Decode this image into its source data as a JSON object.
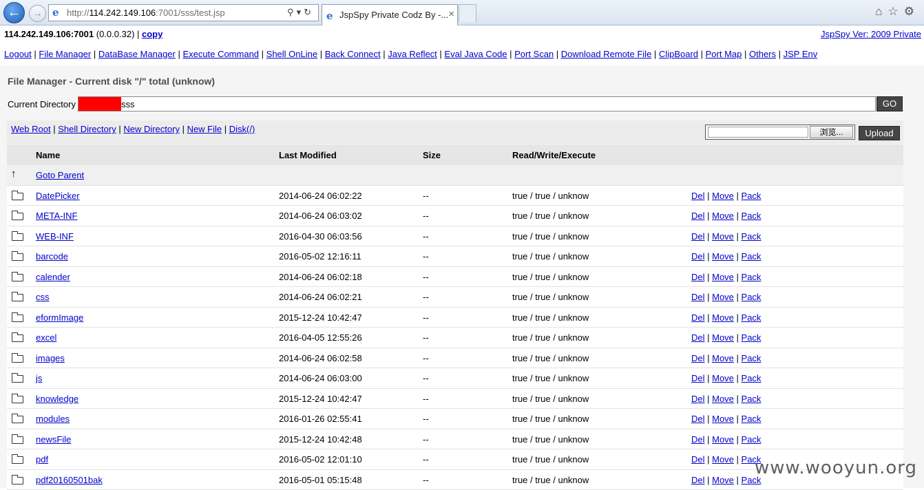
{
  "browser": {
    "url_prefix": "http://",
    "url_host": "114.242.149.106",
    "url_rest": ":7001/sss/test.jsp",
    "tab_title": "JspSpy Private Codz By -...",
    "tab_close": "×",
    "back_icon": "arrow-left-icon",
    "forward_icon": "arrow-right-icon"
  },
  "header": {
    "host": "114.242.149.106:7001",
    "local_ip": " (0.0.0.32) | ",
    "copy_label": "copy",
    "version": "JspSpy Ver: 2009 Private"
  },
  "menu": [
    "Logout",
    "File Manager",
    "DataBase Manager",
    "Execute Command",
    "Shell OnLine",
    "Back Connect",
    "Java Reflect",
    "Eval Java Code",
    "Port Scan",
    "Download Remote File",
    "ClipBoard",
    "Port Map",
    "Others",
    "JSP Env"
  ],
  "file_manager": {
    "title": "File Manager - Current disk \"/\" total (unknow)",
    "current_dir_label": "Current Directory",
    "current_dir_value": "sss",
    "go_label": "GO",
    "op_links": [
      "Web Root",
      "Shell Directory",
      "New Directory",
      "New File",
      "Disk(/)"
    ],
    "browse_label": "浏览...",
    "upload_label": "Upload",
    "columns": [
      "Name",
      "Last Modified",
      "Size",
      "Read/Write/Execute"
    ],
    "goto_parent": "Goto Parent",
    "row_ops": [
      "Del",
      "Move",
      "Pack"
    ],
    "rows": [
      {
        "name": "DatePicker",
        "modified": "2014-06-24 06:02:22",
        "size": "--",
        "rwx": "true / true / unknow"
      },
      {
        "name": "META-INF",
        "modified": "2014-06-24 06:03:02",
        "size": "--",
        "rwx": "true / true / unknow"
      },
      {
        "name": "WEB-INF",
        "modified": "2016-04-30 06:03:56",
        "size": "--",
        "rwx": "true / true / unknow"
      },
      {
        "name": "barcode",
        "modified": "2016-05-02 12:16:11",
        "size": "--",
        "rwx": "true / true / unknow"
      },
      {
        "name": "calender",
        "modified": "2014-06-24 06:02:18",
        "size": "--",
        "rwx": "true / true / unknow"
      },
      {
        "name": "css",
        "modified": "2014-06-24 06:02:21",
        "size": "--",
        "rwx": "true / true / unknow"
      },
      {
        "name": "eformImage",
        "modified": "2015-12-24 10:42:47",
        "size": "--",
        "rwx": "true / true / unknow"
      },
      {
        "name": "excel",
        "modified": "2016-04-05 12:55:26",
        "size": "--",
        "rwx": "true / true / unknow"
      },
      {
        "name": "images",
        "modified": "2014-06-24 06:02:58",
        "size": "--",
        "rwx": "true / true / unknow"
      },
      {
        "name": "js",
        "modified": "2014-06-24 06:03:00",
        "size": "--",
        "rwx": "true / true / unknow"
      },
      {
        "name": "knowledge",
        "modified": "2015-12-24 10:42:47",
        "size": "--",
        "rwx": "true / true / unknow"
      },
      {
        "name": "modules",
        "modified": "2016-01-26 02:55:41",
        "size": "--",
        "rwx": "true / true / unknow"
      },
      {
        "name": "newsFile",
        "modified": "2015-12-24 10:42:48",
        "size": "--",
        "rwx": "true / true / unknow"
      },
      {
        "name": "pdf",
        "modified": "2016-05-02 12:01:10",
        "size": "--",
        "rwx": "true / true / unknow"
      },
      {
        "name": "pdf20160501bak",
        "modified": "2016-05-01 05:15:48",
        "size": "--",
        "rwx": "true / true / unknow"
      }
    ]
  },
  "watermark": "www.wooyun.org"
}
